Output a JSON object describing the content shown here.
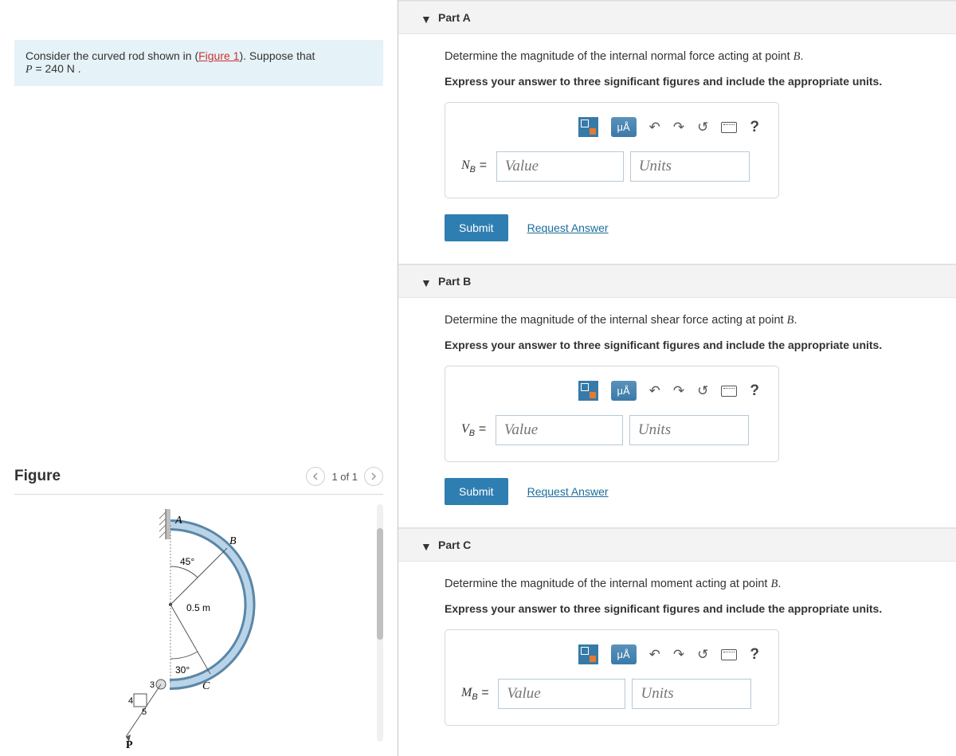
{
  "problem": {
    "intro_pre": "Consider the curved rod shown in (",
    "figure_link": "Figure 1",
    "intro_post": "). Suppose that",
    "var": "P",
    "eq": " = 240  ",
    "unit": "N",
    "tail": " ."
  },
  "figure": {
    "title": "Figure",
    "counter": "1 of 1",
    "labels": {
      "A": "A",
      "B": "B",
      "C": "C",
      "P": "P",
      "ang1": "45°",
      "ang2": "30°",
      "radius": "0.5 m",
      "n3": "3",
      "n4": "4",
      "n5": "5"
    }
  },
  "parts": [
    {
      "title": "Part A",
      "question_pre": "Determine the magnitude of the internal normal force acting at point ",
      "point": "B",
      "question_post": ".",
      "instruct": "Express your answer to three significant figures and include the appropriate units.",
      "var": "N",
      "sub": "B",
      "value_ph": "Value",
      "units_ph": "Units",
      "submit": "Submit",
      "request": "Request Answer",
      "tool_special": "μÅ"
    },
    {
      "title": "Part B",
      "question_pre": "Determine the magnitude of the internal shear force acting at point ",
      "point": "B",
      "question_post": ".",
      "instruct": "Express your answer to three significant figures and include the appropriate units.",
      "var": "V",
      "sub": "B",
      "value_ph": "Value",
      "units_ph": "Units",
      "submit": "Submit",
      "request": "Request Answer",
      "tool_special": "μÅ"
    },
    {
      "title": "Part C",
      "question_pre": "Determine the magnitude of the internal moment acting at point ",
      "point": "B",
      "question_post": ".",
      "instruct": "Express your answer to three significant figures and include the appropriate units.",
      "var": "M",
      "sub": "B",
      "value_ph": "Value",
      "units_ph": "Units",
      "submit": "Submit",
      "request": "Request Answer",
      "tool_special": "μÅ"
    }
  ]
}
